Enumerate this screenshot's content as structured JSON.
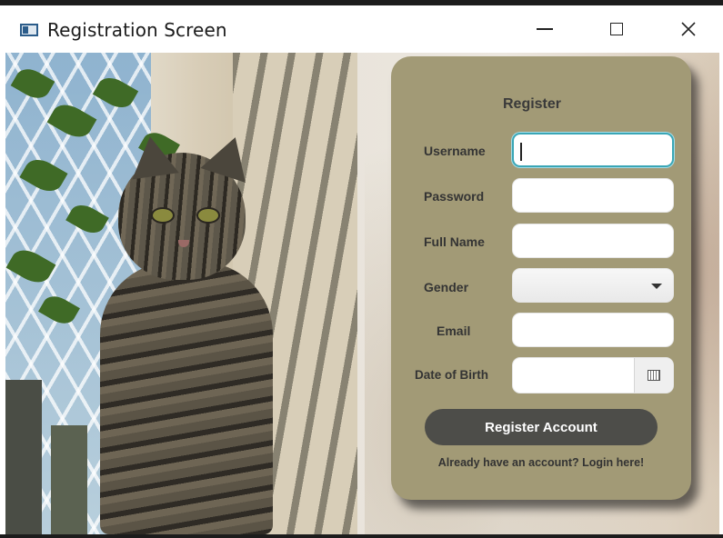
{
  "window": {
    "title": "Registration Screen",
    "icon": "app-window-icon",
    "controls": [
      "minimize",
      "maximize",
      "close"
    ]
  },
  "form": {
    "heading": "Register",
    "fields": [
      {
        "label": "Username",
        "value": "",
        "type": "text",
        "focused": true
      },
      {
        "label": "Password",
        "value": "",
        "type": "password"
      },
      {
        "label": "Full Name",
        "value": "",
        "type": "text"
      },
      {
        "label": "Gender",
        "value": "",
        "type": "select"
      },
      {
        "label": "Email",
        "value": "",
        "type": "text"
      },
      {
        "label": "Date of Birth",
        "value": "",
        "type": "date"
      }
    ],
    "submit_label": "Register Account",
    "login_link": "Already have an account? Login here!"
  },
  "colors": {
    "panel": "#a29a76",
    "button": "#4d4d49",
    "focus_ring": "#3aa6b6"
  }
}
